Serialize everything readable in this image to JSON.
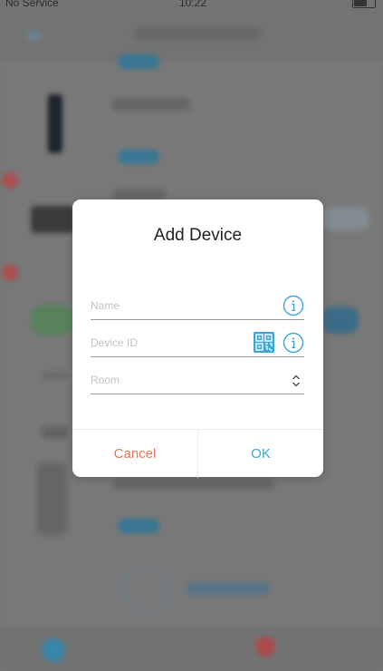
{
  "status_bar": {
    "carrier": "No Service",
    "time": "10:22"
  },
  "dialog": {
    "title": "Add Device",
    "fields": {
      "name": {
        "value": "",
        "placeholder": "Name"
      },
      "device_id": {
        "value": "",
        "placeholder": "Device ID"
      },
      "room": {
        "value": "",
        "placeholder": "Room"
      }
    },
    "buttons": {
      "cancel": "Cancel",
      "ok": "OK"
    }
  },
  "icons": {
    "name_info": "info-icon",
    "device_id_qr": "qr-code-icon",
    "device_id_info": "info-icon",
    "room_select": "chevron-up-down-icon"
  },
  "colors": {
    "accent_blue": "#3ca7d6",
    "cancel_orange": "#e4775a",
    "ok_blue": "#40a7d3"
  }
}
